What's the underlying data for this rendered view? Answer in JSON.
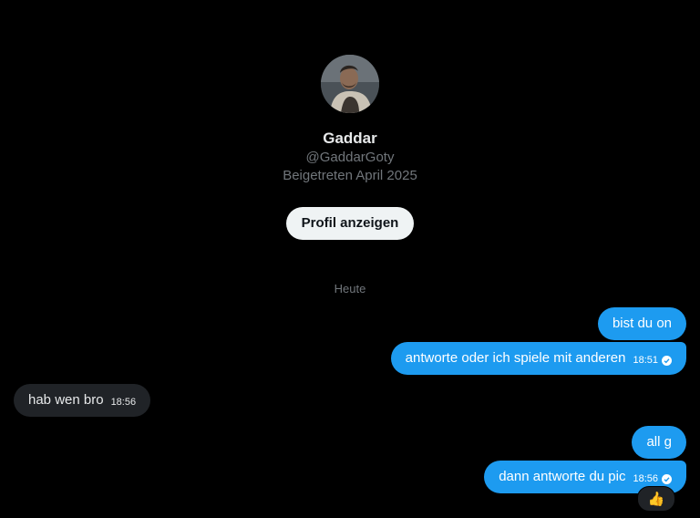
{
  "profile": {
    "name": "Gaddar",
    "handle": "@GaddarGoty",
    "joined": "Beigetreten April 2025",
    "button_label": "Profil anzeigen"
  },
  "day_separator": "Heute",
  "messages": [
    {
      "direction": "sent",
      "text": "bist du on",
      "time": "",
      "read": false
    },
    {
      "direction": "sent",
      "text": "antworte oder ich spiele mit anderen",
      "time": "18:51",
      "read": true
    },
    {
      "direction": "received",
      "text": "hab wen bro",
      "time": "18:56",
      "read": false
    },
    {
      "direction": "sent",
      "text": "all g",
      "time": "",
      "read": false
    },
    {
      "direction": "sent",
      "text": "dann antworte du pic",
      "time": "18:56",
      "read": true
    }
  ],
  "reaction": {
    "emoji": "👍",
    "icon": "thumbs-up-icon"
  },
  "colors": {
    "background": "#000000",
    "sent_bubble": "#1d9bf0",
    "received_bubble": "#202327",
    "muted_text": "#71767b",
    "primary_text": "#e7e9ea",
    "button_bg": "#eff3f4"
  }
}
